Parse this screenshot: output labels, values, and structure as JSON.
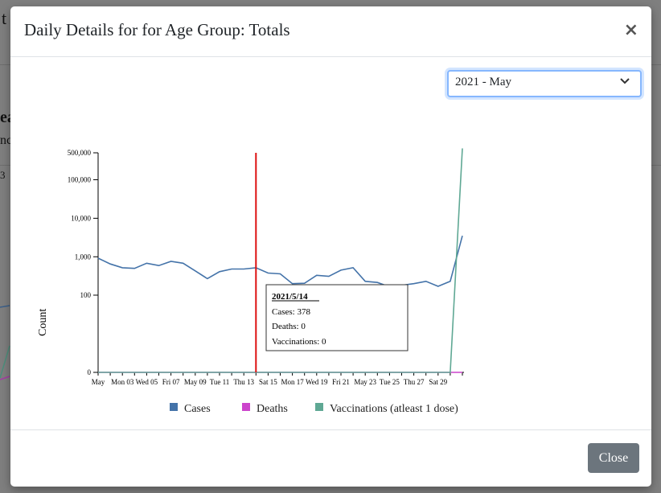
{
  "background": {
    "title_fragment": "t",
    "heading_fragment": "ea",
    "sub_fragment": "nc",
    "small_fragment": "3"
  },
  "modal": {
    "title": "Daily Details for for Age Group: Totals",
    "close_icon": "×",
    "select": {
      "value": "2021 - May",
      "icon": "chevron-down-icon"
    },
    "close_button": "Close"
  },
  "tooltip": {
    "date": "2021/5/14",
    "cases": "Cases: 378",
    "deaths": "Deaths: 0",
    "vaccinations": "Vaccinations: 0"
  },
  "chart_data": {
    "type": "line",
    "ylabel": "Count",
    "xlabel": "",
    "y_scale": "symlog",
    "y_ticks": [
      "0",
      "100",
      "1,000",
      "10,000",
      "100,000",
      "500,000"
    ],
    "x_ticks": [
      "May",
      "Mon 03",
      "Wed 05",
      "Fri 07",
      "May 09",
      "Tue 11",
      "Thu 13",
      "Sat 15",
      "Mon 17",
      "Wed 19",
      "Fri 21",
      "May 23",
      "Tue 25",
      "Thu 27",
      "Sat 29"
    ],
    "x": [
      1,
      2,
      3,
      4,
      5,
      6,
      7,
      8,
      9,
      10,
      11,
      12,
      13,
      14,
      15,
      16,
      17,
      18,
      19,
      20,
      21,
      22,
      23,
      24,
      25,
      26,
      27,
      28,
      29,
      30,
      31
    ],
    "series": [
      {
        "name": "Cases",
        "color": "#4473a9",
        "values": [
          920,
          650,
          520,
          500,
          680,
          590,
          760,
          680,
          430,
          270,
          410,
          480,
          480,
          520,
          378,
          360,
          200,
          205,
          330,
          310,
          450,
          520,
          230,
          215,
          165,
          180,
          200,
          230,
          170,
          230,
          3500
        ]
      },
      {
        "name": "Deaths",
        "color": "#cc44cc",
        "values": [
          0,
          0,
          0,
          0,
          0,
          0,
          0,
          0,
          0,
          0,
          0,
          0,
          0,
          0,
          0,
          0,
          0,
          0,
          0,
          0,
          0,
          0,
          0,
          0,
          0,
          0,
          0,
          0,
          0,
          0,
          0
        ]
      },
      {
        "name": "Vaccinations (atleast 1 dose)",
        "color": "#5fa894",
        "values": [
          0,
          0,
          0,
          0,
          0,
          0,
          0,
          0,
          0,
          0,
          0,
          0,
          0,
          0,
          0,
          0,
          0,
          0,
          0,
          0,
          0,
          0,
          0,
          0,
          0,
          0,
          0,
          0,
          0,
          0,
          650000
        ]
      }
    ],
    "marker_x": 14,
    "marker_color": "#dd1111",
    "legend_position": "bottom",
    "grid": false
  }
}
